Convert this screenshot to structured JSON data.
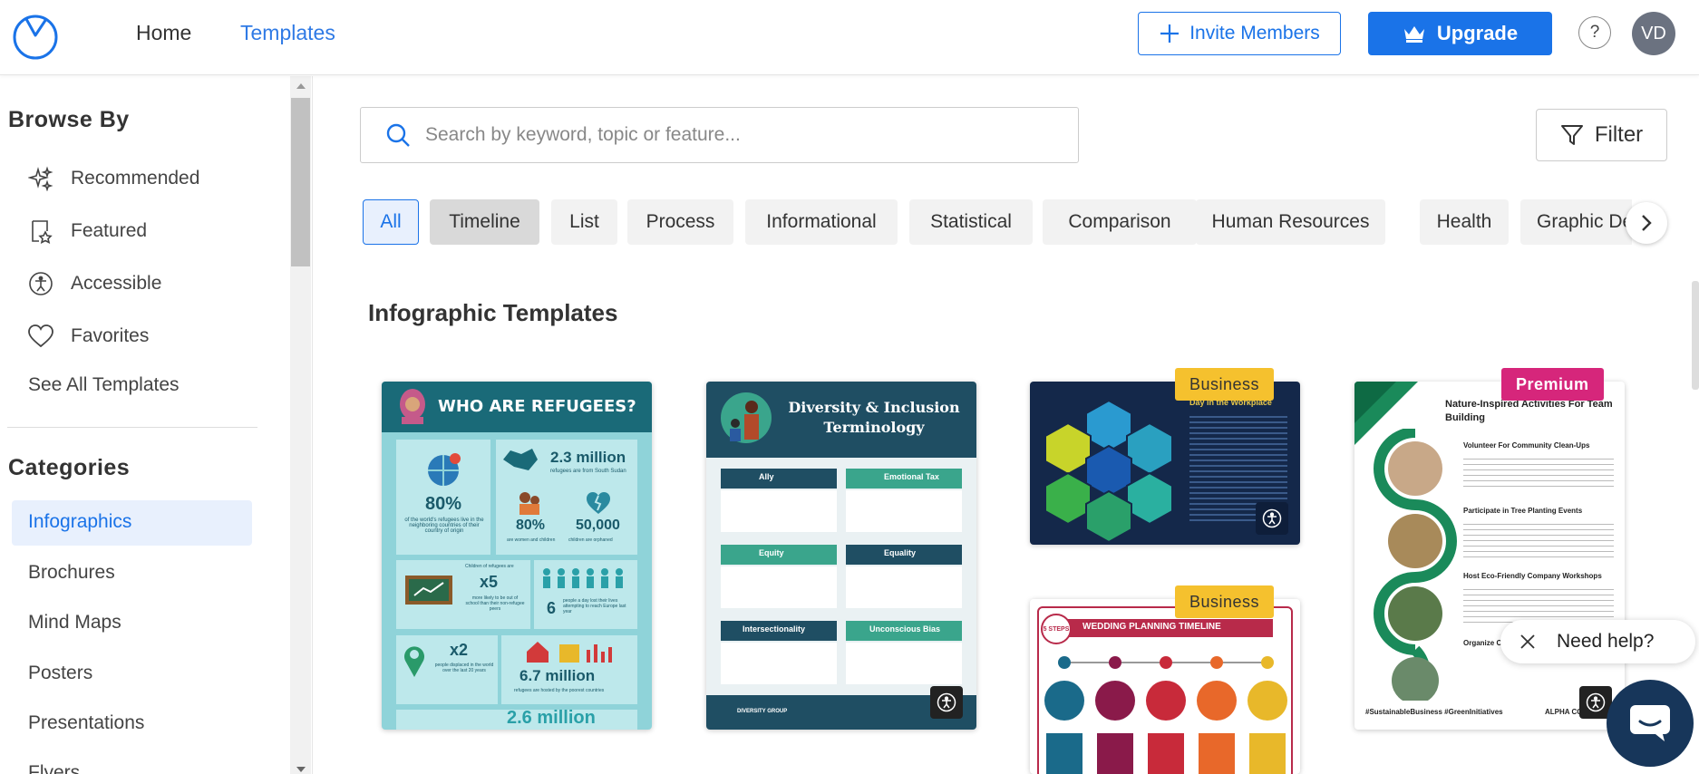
{
  "header": {
    "nav": {
      "home": "Home",
      "templates": "Templates"
    },
    "invite_label": "Invite Members",
    "upgrade_label": "Upgrade",
    "help_label": "?",
    "avatar_initials": "VD"
  },
  "sidebar": {
    "browse_heading": "Browse By",
    "browse_items": [
      {
        "label": "Recommended",
        "icon": "sparkles-icon"
      },
      {
        "label": "Featured",
        "icon": "star-document-icon"
      },
      {
        "label": "Accessible",
        "icon": "accessibility-icon"
      },
      {
        "label": "Favorites",
        "icon": "heart-icon"
      }
    ],
    "see_all": "See All Templates",
    "categories_heading": "Categories",
    "categories": [
      "Infographics",
      "Brochures",
      "Mind Maps",
      "Posters",
      "Presentations",
      "Flyers"
    ],
    "active_category": "Infographics"
  },
  "search": {
    "placeholder": "Search by keyword, topic or feature..."
  },
  "filter_label": "Filter",
  "chips": [
    "All",
    "Timeline",
    "List",
    "Process",
    "Informational",
    "Statistical",
    "Comparison",
    "Human Resources",
    "Health",
    "Graphic De"
  ],
  "active_chip": "All",
  "section_title": "Infographic Templates",
  "cards": {
    "refugees": {
      "title": "WHO ARE REFUGEES?",
      "stat1": "80%",
      "stat1_caption": "of the world's refugees live in the neighboring countries of their country of origin",
      "stat2": "2.3 million",
      "stat2_caption": "refugees are from South Sudan",
      "stat3": "80%",
      "stat3_caption": "are women and children",
      "stat4": "50,000",
      "stat4_caption": "children are orphaned",
      "stat5": "x5",
      "stat5_caption": "more likely to be out of school than their non-refugee peers",
      "stat5_pre": "Children of refugees are",
      "stat6": "6",
      "stat6_caption": "people a day lost their lives attempting to reach Europe last year",
      "stat7": "x2",
      "stat7_caption": "people displaced in the world over the last 20 years",
      "stat8": "6.7 million",
      "stat8_caption": "refugees are hosted by the poorest countries",
      "stat9": "2.6 million"
    },
    "diversity": {
      "title": "Diversity & Inclusion Terminology",
      "terms": [
        "Ally",
        "Emotional Tax",
        "Equity",
        "Equality",
        "Intersectionality",
        "Unconscious Bias"
      ],
      "footer": "DIVERSITY GROUP"
    },
    "workplace": {
      "badge": "Business",
      "title": "Day in the Workplace"
    },
    "wedding": {
      "badge": "Business",
      "title": "WEDDING PLANNING TIMELINE",
      "steps": "5 STEPS"
    },
    "nature": {
      "badge": "Premium",
      "title": "Nature-Inspired Activities For Team Building",
      "items": [
        "Volunteer For Community Clean-Ups",
        "Participate in Tree Planting Events",
        "Host Eco-Friendly Company Workshops",
        "Organize Company-Wide Nature"
      ],
      "footer": "#SustainableBusiness #GreenInitiatives",
      "brand": "ALPHA CO."
    }
  },
  "help": {
    "label": "Need help?"
  },
  "colors": {
    "accent": "#1a73e8",
    "business": "#f5c12e",
    "premium": "#d6267b"
  }
}
